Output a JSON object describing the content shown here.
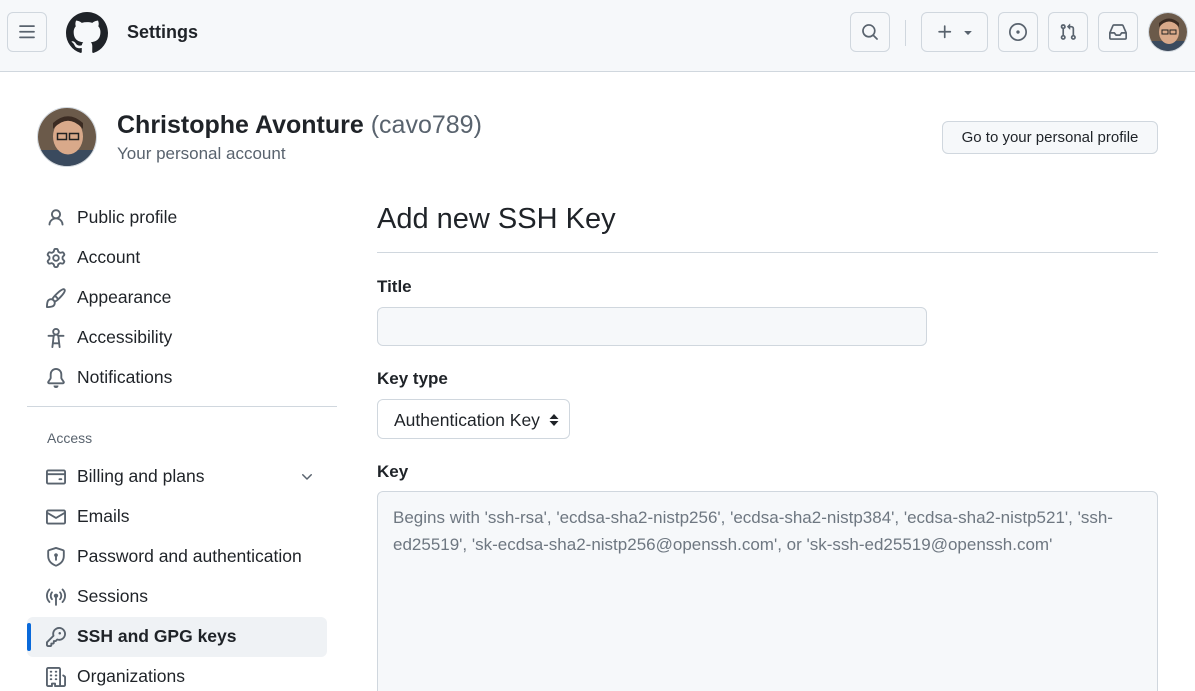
{
  "header": {
    "context_title": "Settings",
    "icons": {
      "menu": "hamburger-icon",
      "logo": "github-mark-icon",
      "search": "search-icon",
      "create": "plus-icon",
      "create_caret": "triangle-down-icon",
      "issues": "issue-opened-icon",
      "pulls": "git-pull-request-icon",
      "inbox": "inbox-icon"
    }
  },
  "profile": {
    "name": "Christophe Avonture",
    "login": "(cavo789)",
    "subtitle": "Your personal account",
    "profile_button": "Go to your personal profile"
  },
  "sidebar": {
    "items": [
      {
        "label": "Public profile",
        "icon": "person-icon"
      },
      {
        "label": "Account",
        "icon": "gear-icon"
      },
      {
        "label": "Appearance",
        "icon": "paintbrush-icon"
      },
      {
        "label": "Accessibility",
        "icon": "accessibility-icon"
      },
      {
        "label": "Notifications",
        "icon": "bell-icon"
      }
    ],
    "access_heading": "Access",
    "access_items": [
      {
        "label": "Billing and plans",
        "icon": "credit-card-icon",
        "expandable": true
      },
      {
        "label": "Emails",
        "icon": "mail-icon"
      },
      {
        "label": "Password and authentication",
        "icon": "shield-lock-icon"
      },
      {
        "label": "Sessions",
        "icon": "broadcast-icon"
      },
      {
        "label": "SSH and GPG keys",
        "icon": "key-icon",
        "active": true
      },
      {
        "label": "Organizations",
        "icon": "organization-icon"
      }
    ]
  },
  "form": {
    "heading": "Add new SSH Key",
    "title_label": "Title",
    "title_value": "",
    "key_type_label": "Key type",
    "key_type_value": "Authentication Key",
    "key_label": "Key",
    "key_placeholder": "Begins with 'ssh-rsa', 'ecdsa-sha2-nistp256', 'ecdsa-sha2-nistp384', 'ecdsa-sha2-nistp521', 'ssh-ed25519', 'sk-ecdsa-sha2-nistp256@openssh.com', or 'sk-ssh-ed25519@openssh.com'"
  },
  "colors": {
    "accent": "#0969da",
    "header_bg": "#f6f8fa",
    "border": "#d0d7de",
    "muted_text": "#59636e"
  }
}
